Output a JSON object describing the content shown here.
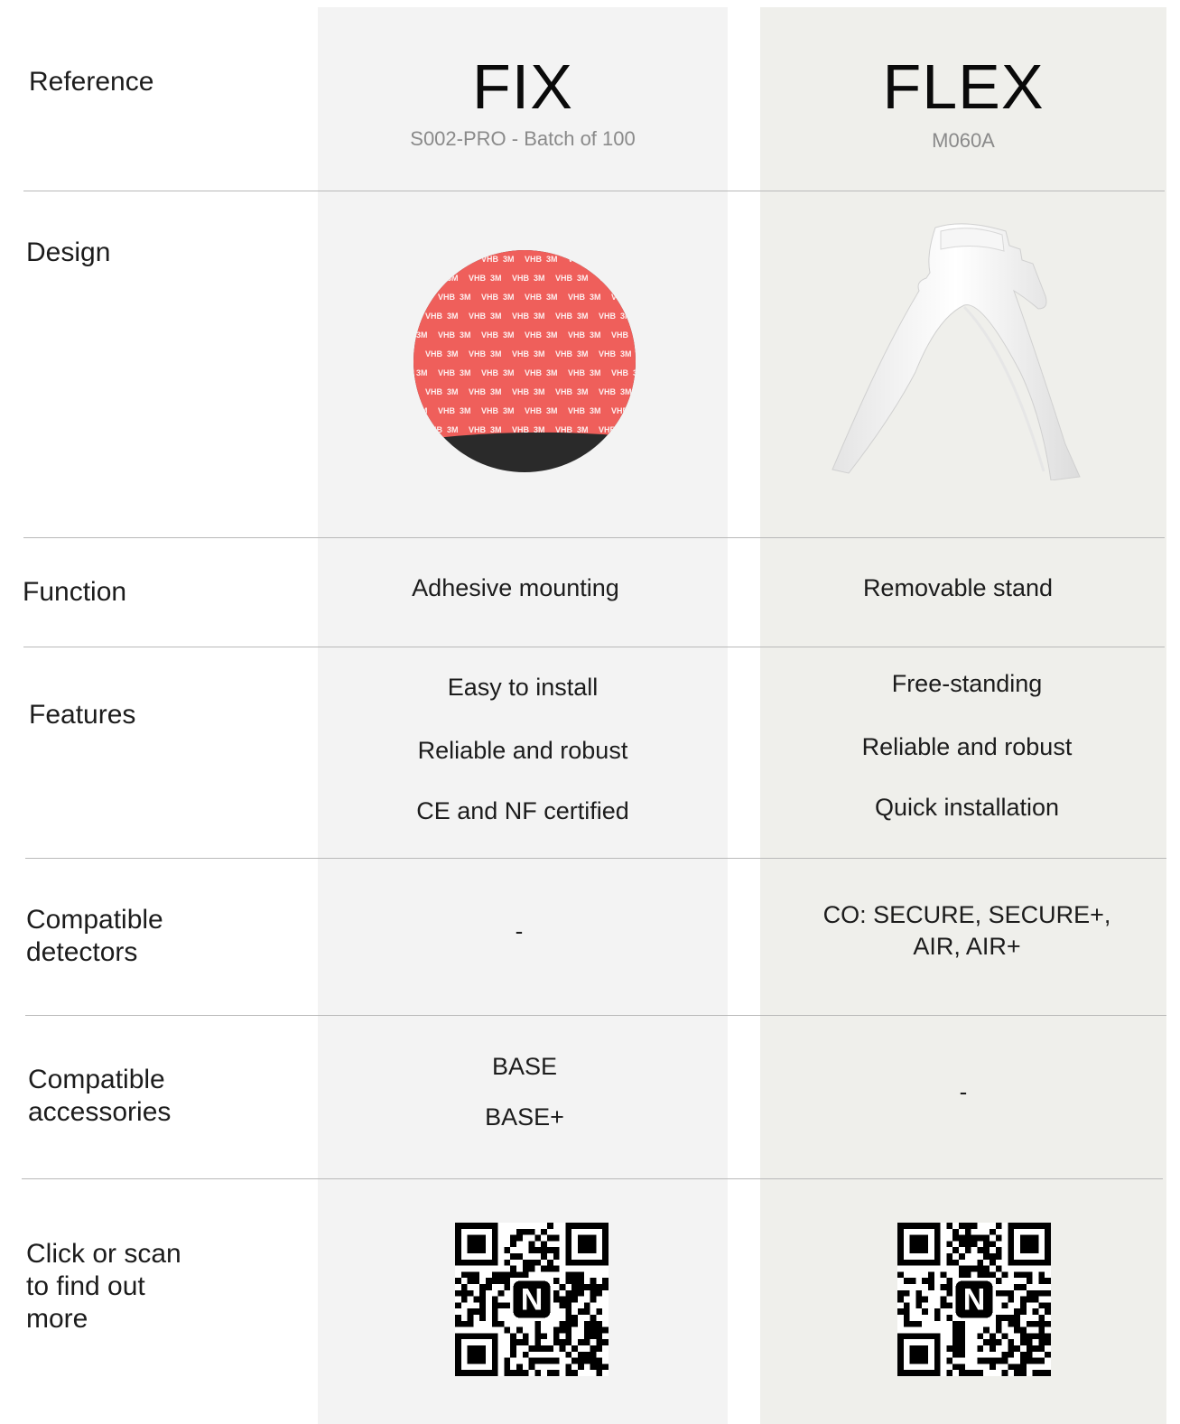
{
  "labels": {
    "reference": "Reference",
    "design": "Design",
    "function": "Function",
    "features": "Features",
    "compatible_detectors": [
      "Compatible",
      "detectors"
    ],
    "compatible_accessories": [
      "Compatible",
      "accessories"
    ],
    "find_more": [
      "Click or scan",
      "to find out",
      "more"
    ]
  },
  "fix": {
    "name": "FIX",
    "reference": "S002-PRO - Batch of 100",
    "function": "Adhesive mounting",
    "features": [
      "Easy to install",
      "Reliable and robust",
      "CE and NF certified"
    ],
    "detectors": "-",
    "accessories": [
      "BASE",
      "BASE+"
    ],
    "patch_text": [
      "3M",
      "VHB"
    ]
  },
  "flex": {
    "name": "FLEX",
    "reference": "M060A",
    "function": "Removable stand",
    "features": [
      "Free-standing",
      "Reliable and robust",
      "Quick installation"
    ],
    "detectors": [
      "CO: SECURE, SECURE+,",
      "AIR, AIR+"
    ],
    "accessories": "-"
  },
  "qr": {
    "logo_letter": "N"
  },
  "colors": {
    "fix_column": "#f3f3f3",
    "flex_column": "#efefeb",
    "patch_red": "#ef5f5b",
    "divider": "#b9b9b9"
  }
}
